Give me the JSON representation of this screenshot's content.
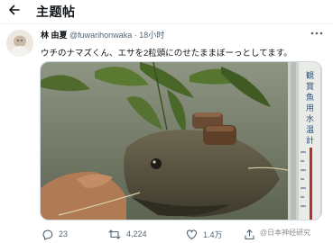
{
  "header": {
    "title": "主题帖"
  },
  "tweet": {
    "author_name": "林 由夏",
    "handle": "@fuwarihonwaka",
    "separator": " · ",
    "time": "18小时",
    "text": "ウチのナマズくん、エサを2粒頭にのせたままぼーっとしてます。",
    "media": {
      "subject": "catfish-with-two-food-pellets",
      "thermometer_text": "観賞魚用水温計"
    }
  },
  "actions": {
    "reply_count": "23",
    "retweet_count": "4,224",
    "like_count": "1.4万"
  },
  "watermark": "@日本神经研究",
  "colors": {
    "text": "#0f1419",
    "secondary": "#536471",
    "border": "#cfd9de"
  }
}
